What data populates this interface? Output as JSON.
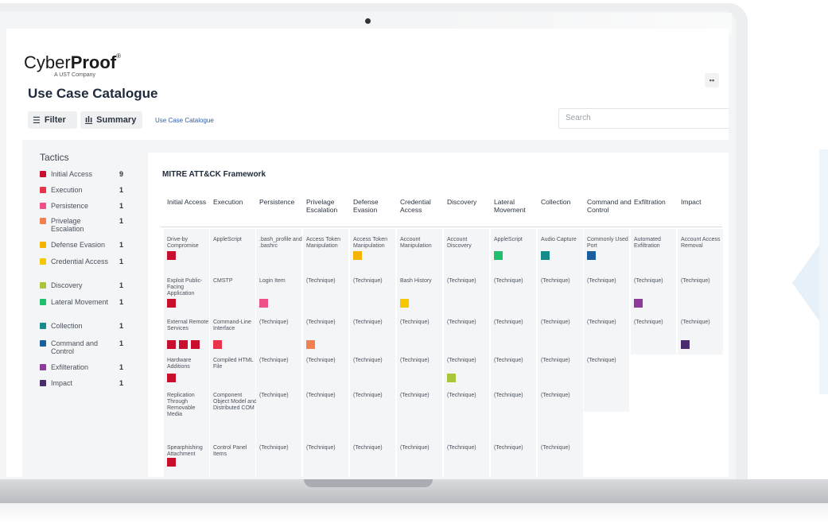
{
  "brand": {
    "name_light": "Cyber",
    "name_bold": "Proof",
    "reg": "®",
    "subtitle": "A UST Company"
  },
  "page_title": "Use Case Catalogue",
  "toolbar": {
    "filter_label": "Filter",
    "summary_label": "Summary",
    "breadcrumb": "Use Case Catalogue",
    "search_placeholder": "Search"
  },
  "tactics": {
    "title": "Tactics",
    "items": [
      {
        "label": "Initial Access",
        "count": "9",
        "color": "#c8102e"
      },
      {
        "label": "Execution",
        "count": "1",
        "color": "#e8334a"
      },
      {
        "label": "Persistence",
        "count": "1",
        "color": "#f0508a"
      },
      {
        "label": "Privelage Escalation",
        "count": "1",
        "color": "#f08050"
      },
      {
        "label": "Defense Evasion",
        "count": "1",
        "color": "#f5b400"
      },
      {
        "label": "Credential Access",
        "count": "1",
        "color": "#f5c800"
      },
      {
        "label": "Discovery",
        "count": "1",
        "color": "#a8c63a"
      },
      {
        "label": "Lateral Movement",
        "count": "1",
        "color": "#1fbf6e"
      },
      {
        "label": "Collection",
        "count": "1",
        "color": "#178a8a"
      },
      {
        "label": "Command and Control",
        "count": "1",
        "color": "#1b5e9e"
      },
      {
        "label": "Exfilteration",
        "count": "1",
        "color": "#8e3a9a"
      },
      {
        "label": "Impact",
        "count": "1",
        "color": "#4a2c6e"
      }
    ]
  },
  "matrix": {
    "title": "MITRE ATT&CK Framework",
    "headers": [
      "Initial Access",
      "Execution",
      "Persistence",
      "Privelage Escalation",
      "Defense Evasion",
      "Credential Access",
      "Discovery",
      "Lateral Movement",
      "Collection",
      "Command and Control",
      "Exfiltration",
      "Impact"
    ],
    "columns": [
      [
        "Drive-by Compromise",
        "Exploit Public-Facing Application",
        "External Remote Services",
        "Hardware Additions",
        "Replication Through Removable Media",
        "Spearphishing Attachment"
      ],
      [
        "AppleScript",
        "CMSTP",
        "Command-Line Interface",
        "Compiled HTML File",
        "Component Object Model and Distributed COM",
        "Control Panel Items"
      ],
      [
        ".bash_profile and .bashrc",
        "Login Item",
        "(Technique)",
        "(Technique)",
        "(Technique)",
        "(Technique)"
      ],
      [
        "Access Token Manipulation",
        "(Technique)",
        "(Technique)",
        "(Technique)",
        "(Technique)",
        "(Technique)"
      ],
      [
        "Access Token Manipulation",
        "(Technique)",
        "(Technique)",
        "(Technique)",
        "(Technique)",
        "(Technique)"
      ],
      [
        "Account Manipulation",
        "Bash History",
        "(Technique)",
        "(Technique)",
        "(Technique)",
        "(Technique)"
      ],
      [
        "Account Discovery",
        "(Technique)",
        "(Technique)",
        "(Technique)",
        "(Technique)",
        "(Technique)"
      ],
      [
        "AppleScript",
        "(Technique)",
        "(Technique)",
        "(Technique)",
        "(Technique)",
        "(Technique)"
      ],
      [
        "Audio Capture",
        "(Technique)",
        "(Technique)",
        "(Technique)",
        "(Technique)",
        "(Technique)"
      ],
      [
        "Commonly Used Port",
        "(Technique)",
        "(Technique)",
        "(Technique)"
      ],
      [
        "Automated Exfiltration",
        "(Technique)",
        "(Technique)"
      ],
      [
        "Account Access Removal",
        "(Technique)",
        "(Technique)"
      ]
    ]
  }
}
